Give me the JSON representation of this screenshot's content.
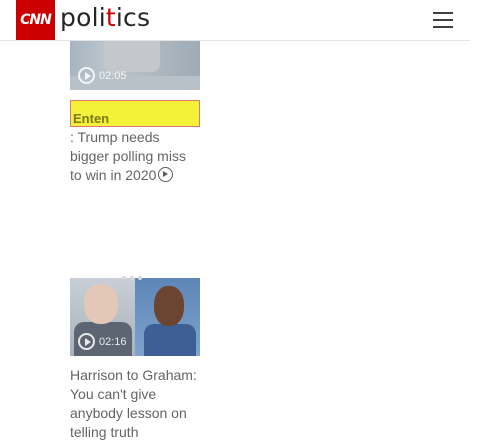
{
  "header": {
    "brand": "CNN",
    "section_prefix": "poli",
    "section_accent": "t",
    "section_suffix": "ics",
    "menu_icon": "hamburger-menu-icon",
    "accent_color": "#cc0000"
  },
  "videos": [
    {
      "duration": "02:05",
      "highlight_text": "Enten",
      "headline": ": Trump needs bigger polling miss to win in 2020",
      "icon": "play-icon"
    },
    {
      "duration": "02:16",
      "headline": "Harrison to Graham: You can't give anybody lesson on telling truth",
      "icon": "play-icon"
    }
  ]
}
